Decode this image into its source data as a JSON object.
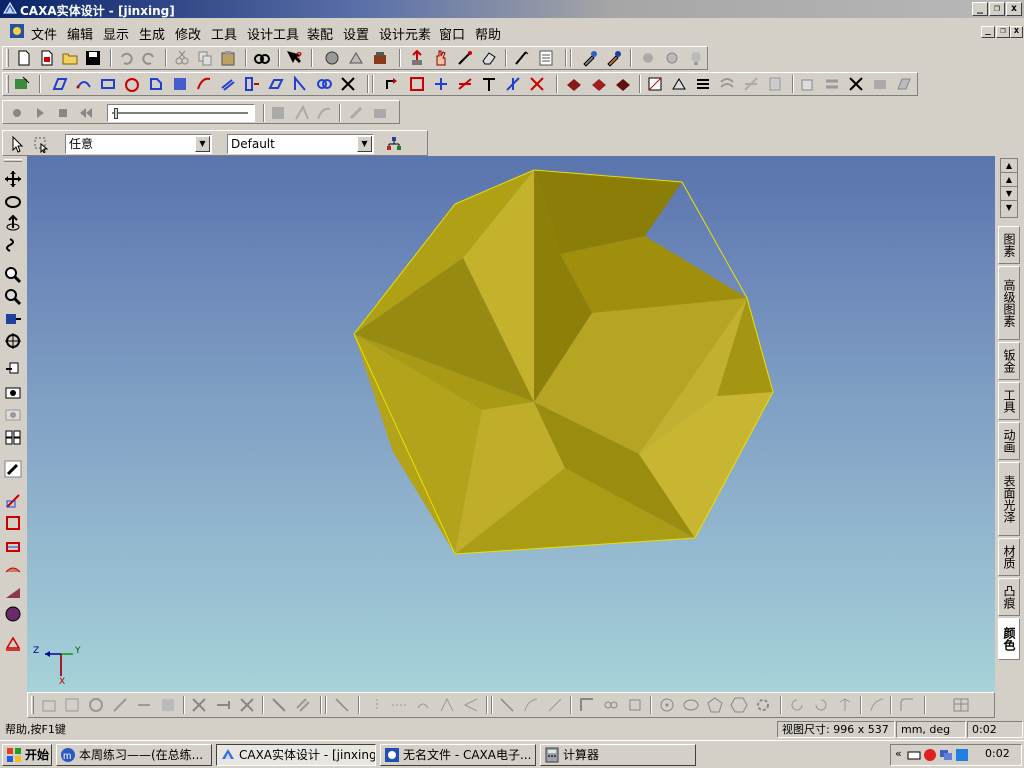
{
  "window": {
    "title": "CAXA实体设计 - [jinxing]"
  },
  "menu": [
    "文件",
    "编辑",
    "显示",
    "生成",
    "修改",
    "工具",
    "设计工具",
    "装配",
    "设置",
    "设计元素",
    "窗口",
    "帮助"
  ],
  "toolbar": {
    "select_mode": "任意",
    "style": "Default"
  },
  "right_tabs": [
    "图素",
    "高级图素",
    "钣金",
    "工具",
    "动画",
    "表面光泽",
    "材质",
    "凸痕",
    "颜色"
  ],
  "axis": {
    "z": "Z",
    "y": "Y",
    "x": "X"
  },
  "status": {
    "help": "帮助,按F1键",
    "view_size": "视图尺寸: 996 x 537",
    "units": "mm, deg",
    "time": "0:02"
  },
  "taskbar": {
    "start": "开始",
    "tasks": [
      "本周练习——(在总练...",
      "CAXA实体设计 - [jinxing]",
      "无名文件 - CAXA电子...",
      "计算器"
    ],
    "clock": "0:02"
  },
  "colors": {
    "model": "#a89a10",
    "viewport_top": "#5a74ad",
    "viewport_bottom": "#a6d2d8",
    "title_active": "#0a246a"
  }
}
